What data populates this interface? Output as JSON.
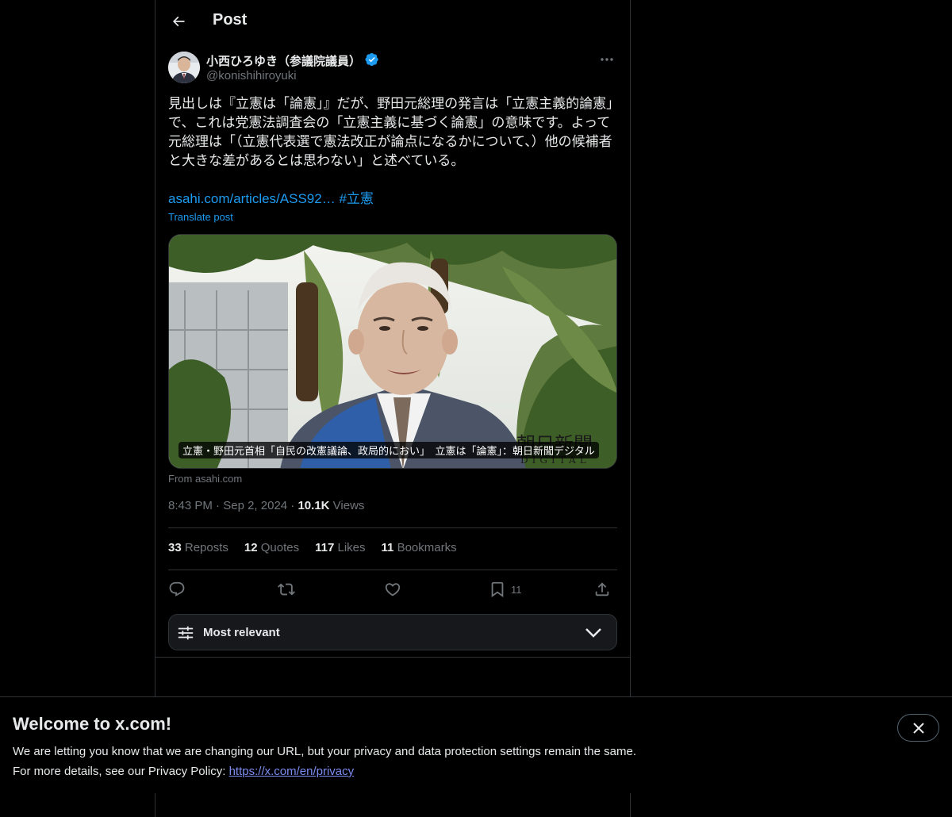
{
  "header": {
    "title": "Post"
  },
  "author": {
    "name": "小西ひろゆき（参議院議員）",
    "handle": "@konishihiroyuki",
    "verified_color": "#1d9bf0"
  },
  "post": {
    "text": "見出しは『立憲は「論憲」』だが、野田元総理の発言は「立憲主義的論憲」で、これは党憲法調査会の「立憲主義に基づく論憲」の意味です。よって元総理は「（立憲代表選で憲法改正が論点になるかについて、）他の候補者と大きな差があるとは思わない」と述べている。",
    "link": "asahi.com/articles/ASS92…",
    "hashtag": "#立憲",
    "translate_label": "Translate post"
  },
  "card": {
    "caption": "立憲・野田元首相「自民の改憲議論、政局的におい」　立憲は「論憲」：朝日新聞デジタル",
    "watermark": "朝日新聞",
    "watermark_sub": "DIGITAL",
    "source": "From asahi.com"
  },
  "meta": {
    "time": "8:43 PM",
    "date": "Sep 2, 2024",
    "views_count": "10.1K",
    "views_label": "Views"
  },
  "stats": [
    {
      "count": "33",
      "label": "Reposts"
    },
    {
      "count": "12",
      "label": "Quotes"
    },
    {
      "count": "117",
      "label": "Likes"
    },
    {
      "count": "11",
      "label": "Bookmarks"
    }
  ],
  "actions": {
    "bookmark_count": "11",
    "icons": [
      "reply-icon",
      "repost-icon",
      "like-icon",
      "bookmark-icon",
      "share-icon"
    ]
  },
  "sort": {
    "label": "Most relevant"
  },
  "banner": {
    "title": "Welcome to x.com!",
    "line1": "We are letting you know that we are changing our URL, but your privacy and data protection settings remain the same.",
    "line2_prefix": "For more details, see our Privacy Policy: ",
    "link": "https://x.com/en/privacy"
  },
  "colors": {
    "background": "#000000",
    "text": "#e7e9ea",
    "muted": "#71767b",
    "accent": "#1d9bf0",
    "border": "#2f3336"
  }
}
